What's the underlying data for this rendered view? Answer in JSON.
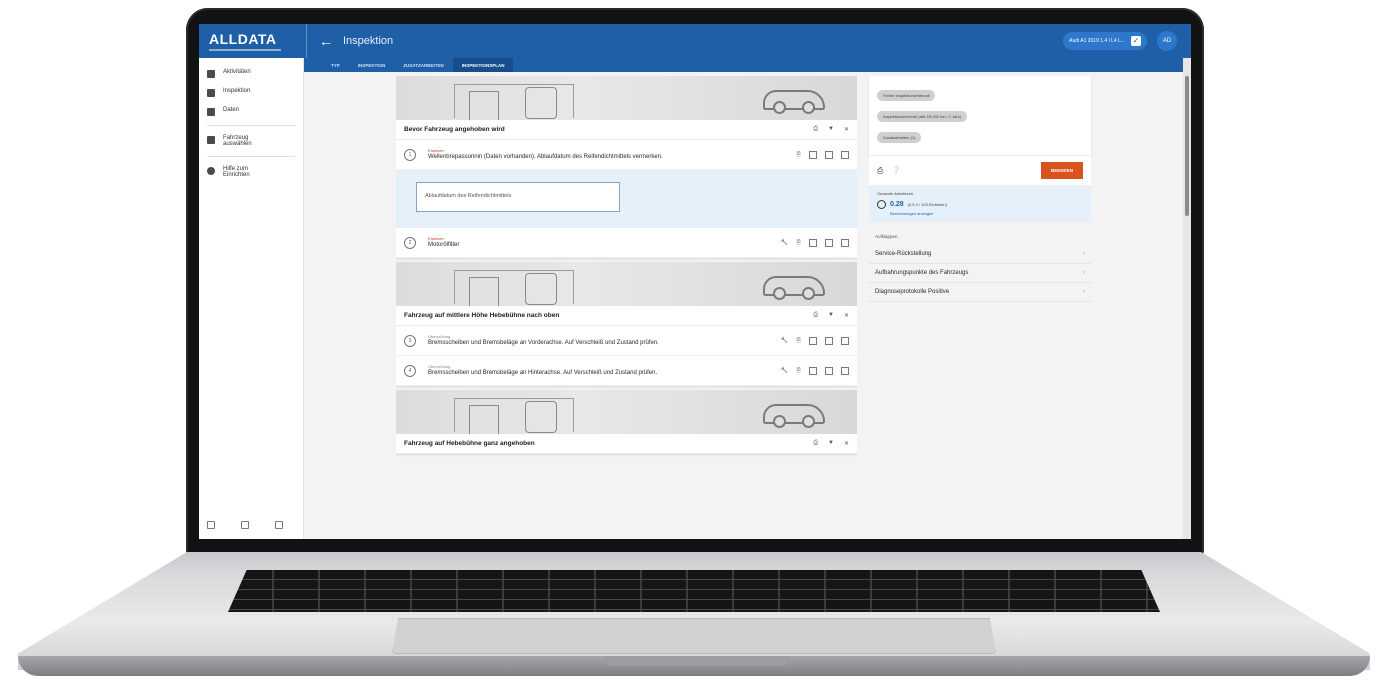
{
  "app": {
    "logo": "ALLDATA",
    "title": "Inspektion",
    "vehicle_pill": "Audi A1 2019 1.4 l L4 L...",
    "avatar": "AD"
  },
  "sidebar": {
    "items": [
      {
        "label": "Aktivitäten",
        "icon": "list-icon"
      },
      {
        "label": "Inspektion",
        "icon": "checklist-icon"
      },
      {
        "label": "Daten",
        "icon": "wrench-icon"
      }
    ],
    "vehicle_item": {
      "label": "Fahrzeug auswählen",
      "icon": "car-icon"
    },
    "help_item": {
      "label": "Hilfe zum Einrichten",
      "icon": "help-icon"
    },
    "bottom_icons": [
      "settings-icon",
      "flag-icon",
      "exit-icon"
    ]
  },
  "tabs": [
    "TYP",
    "INSPEKTION",
    "ZUSATZARBEITEN",
    "INSPEKTIONSPLAN"
  ],
  "sections": [
    {
      "title": "Bevor Fahrzeug angehoben wird",
      "rows": [
        {
          "num": "1",
          "kicker": "Ersetzen",
          "text": "Wellenbrepassonnin (Daten vorhanden). Ablaufdatum des Reifendichtmittels vermerken."
        },
        {
          "num": "2",
          "kicker": "Ersetzen",
          "text": "Motorölfilter"
        }
      ],
      "note_placeholder": "Ablaufdatum des Reifendichtmittels"
    },
    {
      "title": "Fahrzeug auf mittlere Höhe Hebebühne nach oben",
      "rows": [
        {
          "num": "3",
          "kicker": "Überprüfung",
          "text": "Bremsscheiben und Bremsbeläge an Vorderachse. Auf Verschleiß und Zustand prüfen."
        },
        {
          "num": "4",
          "kicker": "Überprüfung",
          "text": "Bremsscheiben und Bremsbeläge an Hinterachse. Auf Verschleiß und Zustand prüfen."
        }
      ]
    },
    {
      "title": "Fahrzeug auf Hebebühne ganz angehoben",
      "rows": []
    }
  ],
  "right_panel": {
    "chips": [
      "Fehler Inspektionsintervall",
      "Inspektionsintervall (alle 15.000 km / 1 Jahr)",
      "Zusatzarbeiten (1)"
    ],
    "primary_button": "BEENDEN",
    "time_label": "Gesamte Arbeitszeit",
    "time_value": "0.28",
    "time_detail": "(0.5 h / 100 Einheiten)",
    "time_link": "Berechnungen anzeigen",
    "links_label": "Aufklappen",
    "links": [
      "Service-Rückstellung",
      "Aufbahrungspunkte des Fahrzeugs",
      "Diagnoseprotokolle Positive"
    ]
  }
}
